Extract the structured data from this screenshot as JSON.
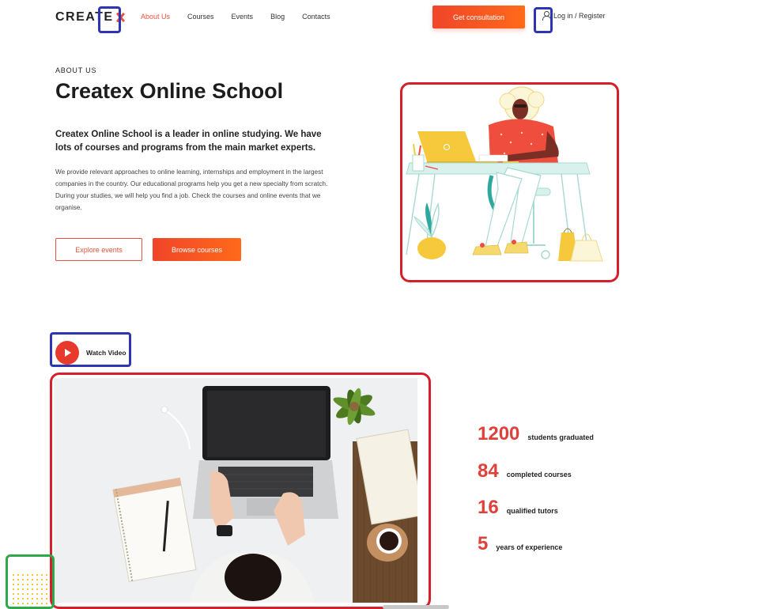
{
  "header": {
    "logo_text": "CREATE",
    "logo_mark": "x-mark-icon",
    "nav": [
      {
        "label": "About Us",
        "active": true
      },
      {
        "label": "Courses",
        "active": false
      },
      {
        "label": "Events",
        "active": false
      },
      {
        "label": "Blog",
        "active": false
      },
      {
        "label": "Contacts",
        "active": false
      }
    ],
    "cta_label": "Get consultation",
    "login_label": "Log in / Register"
  },
  "about": {
    "eyebrow": "ABOUT US",
    "title": "Createx Online School",
    "lead": "Createx Online School is a leader in online studying. We have lots of courses and programs from the main market experts.",
    "body": "We provide relevant approaches to online learning, internships and employment in the largest companies in the country. Our educational programs help you get a new specialty from scratch. During your studies, we will help you find a job. Check the courses and online events that we organise.",
    "explore_label": "Explore events",
    "browse_label": "Browse courses"
  },
  "video": {
    "watch_label": "Watch Video"
  },
  "stats": [
    {
      "value": "1200",
      "label": "students graduated"
    },
    {
      "value": "84",
      "label": "completed courses"
    },
    {
      "value": "16",
      "label": "qualified tutors"
    },
    {
      "value": "5",
      "label": "years of experience"
    }
  ],
  "colors": {
    "accent": "#e8513a",
    "annotation_blue": "#2e35b4",
    "annotation_red": "#d51f2b",
    "annotation_green": "#2ea84a"
  }
}
